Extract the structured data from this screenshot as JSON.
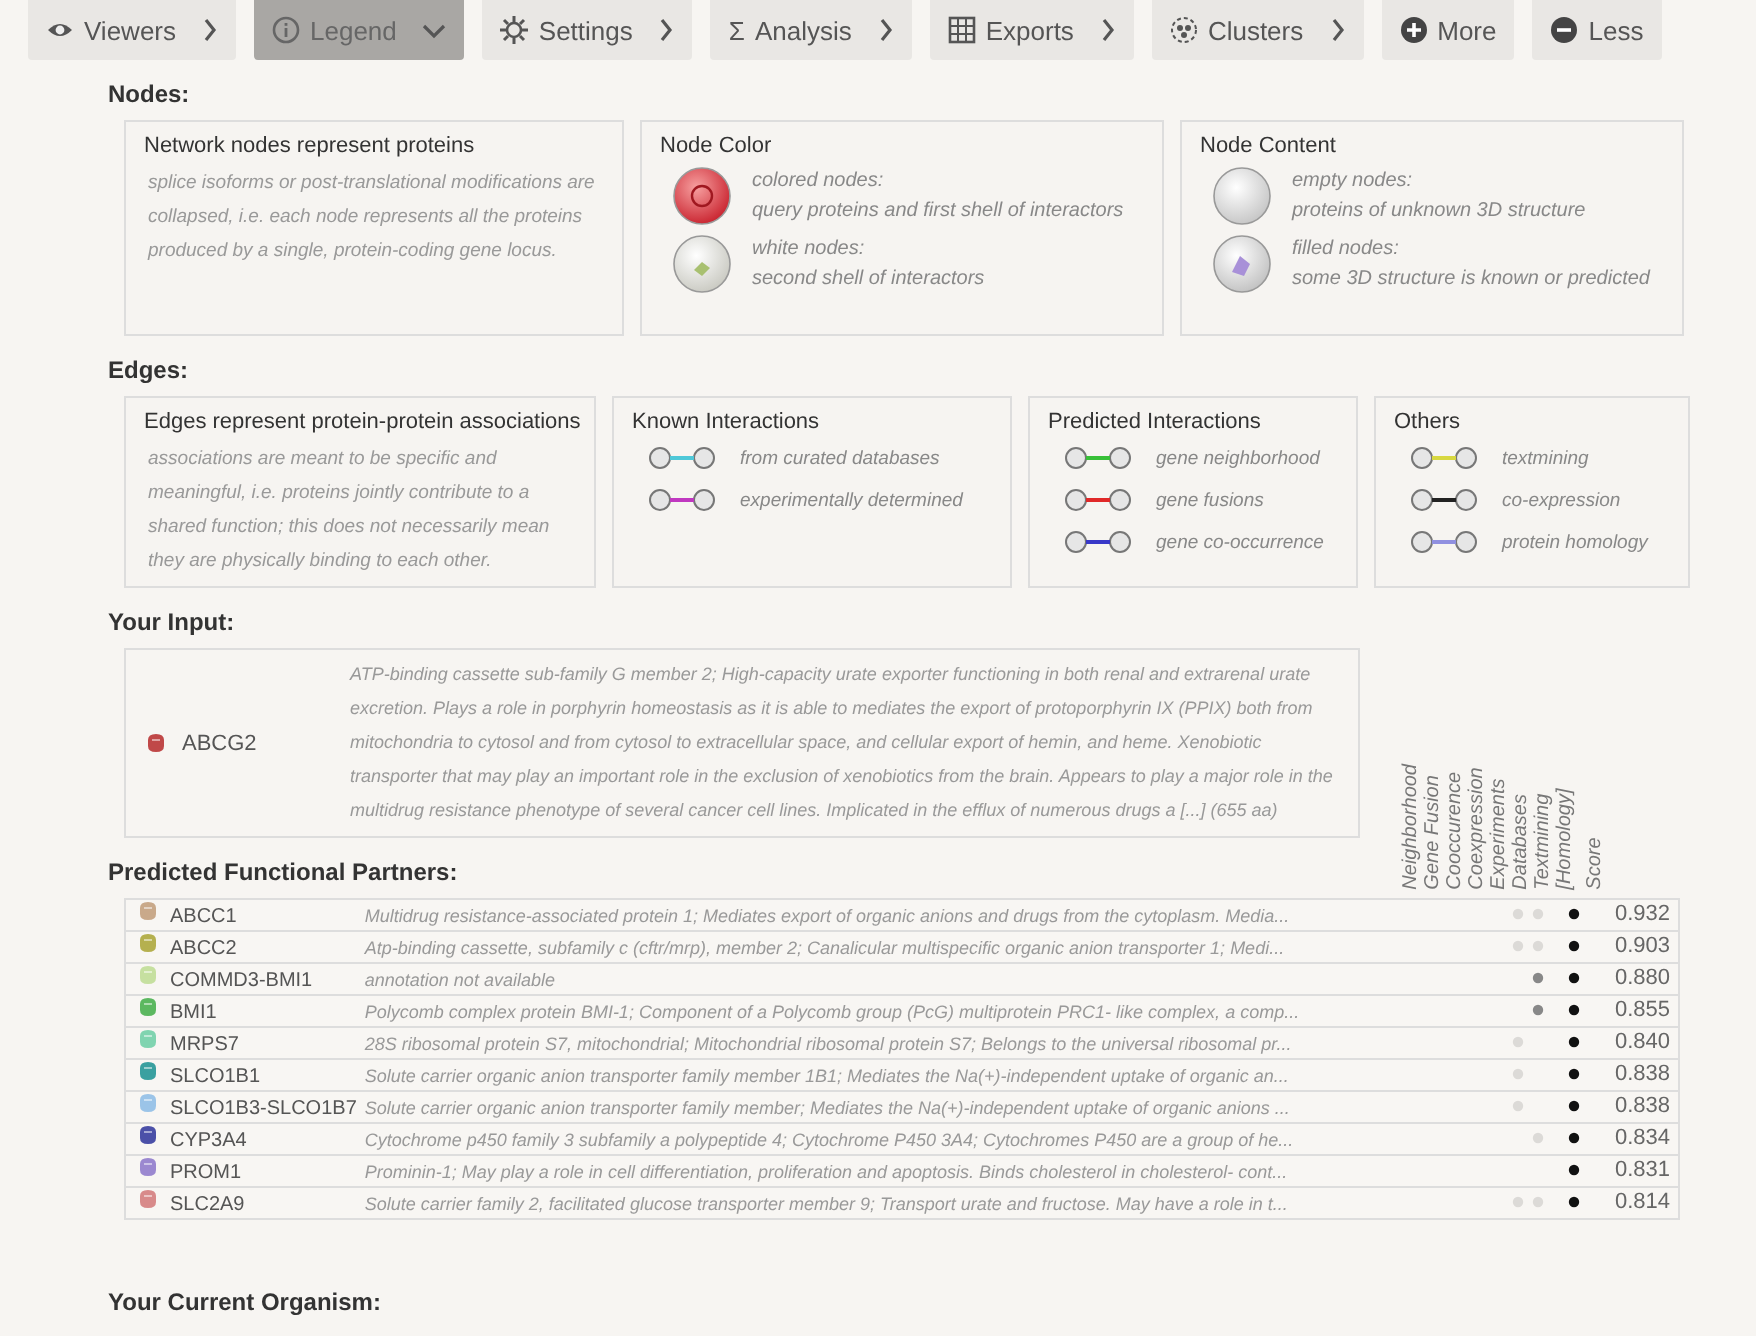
{
  "toolbar": [
    {
      "label": "Viewers",
      "expanded": false,
      "selected": false
    },
    {
      "label": "Legend",
      "expanded": true,
      "selected": true
    },
    {
      "label": "Settings",
      "expanded": false,
      "selected": false
    },
    {
      "label": "Analysis",
      "symbol": "Σ",
      "expanded": false,
      "selected": false
    },
    {
      "label": "Exports",
      "expanded": false,
      "selected": false
    },
    {
      "label": "Clusters",
      "expanded": false,
      "selected": false
    },
    {
      "label": "More",
      "selected": false
    },
    {
      "label": "Less",
      "selected": false
    }
  ],
  "nodes": {
    "title": "Nodes:",
    "cards": [
      {
        "title": "Network nodes represent proteins",
        "text": "splice isoforms or post-translational modifications are collapsed, i.e. each node represents all the proteins produced by a single, protein-coding gene locus."
      },
      {
        "title": "Node Color",
        "items": [
          {
            "kind": "colored",
            "label": "colored nodes:",
            "text": "query proteins and first shell of interactors"
          },
          {
            "kind": "white",
            "label": "white nodes:",
            "text": "second shell of interactors"
          }
        ]
      },
      {
        "title": "Node Content",
        "items": [
          {
            "kind": "empty",
            "label": "empty nodes:",
            "text": "proteins of unknown 3D structure"
          },
          {
            "kind": "filled",
            "label": "filled nodes:",
            "text": "some 3D structure is known or predicted"
          }
        ]
      }
    ]
  },
  "edges": {
    "title": "Edges:",
    "cards": [
      {
        "title": "Edges represent protein-protein associations",
        "text": "associations are meant to be specific and meaningful, i.e. proteins jointly contribute to a shared function; this does not necessarily mean they are physically binding to each other."
      },
      {
        "title": "Known Interactions",
        "items": [
          {
            "color": "#4fc8d8",
            "label": "from curated databases"
          },
          {
            "color": "#c038c0",
            "label": "experimentally determined"
          }
        ]
      },
      {
        "title": "Predicted Interactions",
        "items": [
          {
            "color": "#38c038",
            "label": "gene neighborhood"
          },
          {
            "color": "#e02828",
            "label": "gene fusions"
          },
          {
            "color": "#3838c8",
            "label": "gene co-occurrence"
          }
        ]
      },
      {
        "title": "Others",
        "items": [
          {
            "color": "#d8d840",
            "label": "textmining"
          },
          {
            "color": "#222222",
            "label": "co-expression"
          },
          {
            "color": "#9090e0",
            "label": "protein homology"
          }
        ]
      }
    ]
  },
  "input": {
    "title": "Your Input:",
    "protein": {
      "name": "ABCG2",
      "color": "#c04848",
      "description": "ATP-binding cassette sub-family G member 2; High-capacity urate exporter functioning in both renal and extrarenal urate excretion. Plays a role in porphyrin homeostasis as it is able to mediates the export of protoporphyrin IX (PPIX) both from mitochondria to cytosol and from cytosol to extracellular space, and cellular export of hemin, and heme. Xenobiotic transporter that may play an important role in the exclusion of xenobiotics from the brain. Appears to play a major role in the multidrug resistance phenotype of several cancer cell lines. Implicated in the efflux of numerous drugs a [...] (655 aa)"
    }
  },
  "partners": {
    "title": "Predicted Functional Partners:",
    "columns": [
      "Neighborhood",
      "Gene Fusion",
      "Cooccurence",
      "Coexpression",
      "Experiments",
      "Databases",
      "Textmining",
      "[Homology]",
      "Score"
    ],
    "rows": [
      {
        "name": "ABCC1",
        "color": "#c9a98a",
        "description": "Multidrug resistance-associated protein 1; Mediates export of organic anions and drugs from the cytoplasm. Media...",
        "evidence": [
          {
            "kind": "none"
          },
          {
            "kind": "none"
          },
          {
            "kind": "none"
          },
          {
            "kind": "faint"
          },
          {
            "kind": "faint"
          },
          {
            "kind": "none"
          },
          {
            "kind": "strong"
          },
          {
            "kind": "none"
          }
        ],
        "score": "0.932"
      },
      {
        "name": "ABCC2",
        "color": "#b5b04f",
        "description": "Atp-binding cassette, subfamily c (cftr/mrp), member 2; Canalicular multispecific organic anion transporter 1; Medi...",
        "evidence": [
          {
            "kind": "none"
          },
          {
            "kind": "none"
          },
          {
            "kind": "none"
          },
          {
            "kind": "faint"
          },
          {
            "kind": "faint"
          },
          {
            "kind": "none"
          },
          {
            "kind": "strong"
          },
          {
            "kind": "none"
          }
        ],
        "score": "0.903"
      },
      {
        "name": "COMMD3-BMI1",
        "color": "#c6e0a0",
        "description": "annotation not available",
        "evidence": [
          {
            "kind": "none"
          },
          {
            "kind": "none"
          },
          {
            "kind": "none"
          },
          {
            "kind": "none"
          },
          {
            "kind": "medium"
          },
          {
            "kind": "none"
          },
          {
            "kind": "strong"
          },
          {
            "kind": "none"
          }
        ],
        "score": "0.880"
      },
      {
        "name": "BMI1",
        "color": "#5cb860",
        "description": "Polycomb complex protein BMI-1; Component of a Polycomb group (PcG) multiprotein PRC1- like complex, a comp...",
        "evidence": [
          {
            "kind": "none"
          },
          {
            "kind": "none"
          },
          {
            "kind": "none"
          },
          {
            "kind": "none"
          },
          {
            "kind": "medium"
          },
          {
            "kind": "none"
          },
          {
            "kind": "strong"
          },
          {
            "kind": "none"
          }
        ],
        "score": "0.855"
      },
      {
        "name": "MRPS7",
        "color": "#80d4b0",
        "description": "28S ribosomal protein S7, mitochondrial; Mitochondrial ribosomal protein S7; Belongs to the universal ribosomal pr...",
        "evidence": [
          {
            "kind": "none"
          },
          {
            "kind": "none"
          },
          {
            "kind": "none"
          },
          {
            "kind": "faint"
          },
          {
            "kind": "none"
          },
          {
            "kind": "none"
          },
          {
            "kind": "strong"
          },
          {
            "kind": "none"
          }
        ],
        "score": "0.840"
      },
      {
        "name": "SLCO1B1",
        "color": "#3aa0a0",
        "description": "Solute carrier organic anion transporter family member 1B1; Mediates the Na(+)-independent uptake of organic an...",
        "evidence": [
          {
            "kind": "none"
          },
          {
            "kind": "none"
          },
          {
            "kind": "none"
          },
          {
            "kind": "faint"
          },
          {
            "kind": "none"
          },
          {
            "kind": "none"
          },
          {
            "kind": "strong"
          },
          {
            "kind": "none"
          }
        ],
        "score": "0.838"
      },
      {
        "name": "SLCO1B3-SLCO1B7",
        "color": "#9bc4e8",
        "description": "Solute carrier organic anion transporter family member; Mediates the Na(+)-independent uptake of organic anions ...",
        "evidence": [
          {
            "kind": "none"
          },
          {
            "kind": "none"
          },
          {
            "kind": "none"
          },
          {
            "kind": "faint"
          },
          {
            "kind": "none"
          },
          {
            "kind": "none"
          },
          {
            "kind": "strong"
          },
          {
            "kind": "none"
          }
        ],
        "score": "0.838"
      },
      {
        "name": "CYP3A4",
        "color": "#4b50a8",
        "description": "Cytochrome p450 family 3 subfamily a polypeptide 4; Cytochrome P450 3A4; Cytochromes P450 are a group of he...",
        "evidence": [
          {
            "kind": "none"
          },
          {
            "kind": "none"
          },
          {
            "kind": "none"
          },
          {
            "kind": "none"
          },
          {
            "kind": "faint"
          },
          {
            "kind": "none"
          },
          {
            "kind": "strong"
          },
          {
            "kind": "none"
          }
        ],
        "score": "0.834"
      },
      {
        "name": "PROM1",
        "color": "#9b88d0",
        "description": "Prominin-1; May play a role in cell differentiation, proliferation and apoptosis. Binds cholesterol in cholesterol- cont...",
        "evidence": [
          {
            "kind": "none"
          },
          {
            "kind": "none"
          },
          {
            "kind": "none"
          },
          {
            "kind": "none"
          },
          {
            "kind": "none"
          },
          {
            "kind": "none"
          },
          {
            "kind": "strong"
          },
          {
            "kind": "none"
          }
        ],
        "score": "0.831"
      },
      {
        "name": "SLC2A9",
        "color": "#d88a8a",
        "description": "Solute carrier family 2, facilitated glucose transporter member 9; Transport urate and fructose. May have a role in t...",
        "evidence": [
          {
            "kind": "none"
          },
          {
            "kind": "none"
          },
          {
            "kind": "none"
          },
          {
            "kind": "faint"
          },
          {
            "kind": "faint"
          },
          {
            "kind": "none"
          },
          {
            "kind": "strong"
          },
          {
            "kind": "none"
          }
        ],
        "score": "0.814"
      }
    ]
  },
  "organism": {
    "title": "Your Current Organism:"
  }
}
